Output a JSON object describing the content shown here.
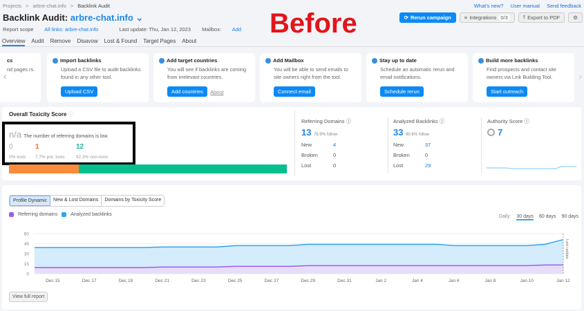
{
  "breadcrumb": [
    "Projects",
    ">",
    "arbre-chat.info",
    ">",
    "Backlink Audit"
  ],
  "header": {
    "title": "Backlink Audit:",
    "domain": "arbre-chat.info ⌄",
    "scope_label": "Report scope",
    "scope_value": "All links: arbre-chat.info",
    "last_update": "Last update: Thu, Jan 12, 2023",
    "mailbox_label": "Mailbox:",
    "mailbox_value": "Add"
  },
  "annotation": "Before",
  "toplinks": [
    "What's new?",
    "User manual",
    "Send feedback"
  ],
  "buttons": {
    "rerun": "Rerun campaign",
    "integrations": "Integrations",
    "integrations_count": "0/3",
    "export": "Export to PDF"
  },
  "tabs": [
    "Overview",
    "Audit",
    "Remove",
    "Disavow",
    "Lost & Found",
    "Target Pages",
    "About"
  ],
  "cards": [
    {
      "title": "cs",
      "text": "nd pages rs."
    },
    {
      "title": "Import backlinks",
      "text": "Upload a CSV file to audit backlinks found in any other tool.",
      "button": "Upload CSV"
    },
    {
      "title": "Add target countries",
      "text": "You will see if backlinks are coming from irrelevant countries.",
      "button": "Add countries",
      "link": "About"
    },
    {
      "title": "Add Mailbox",
      "text": "You will be able to send emails to site owners right from the tool.",
      "button": "Connect email"
    },
    {
      "title": "Stay up to date",
      "text": "Schedule an automatic rerun and email notifications.",
      "button": "Schedule rerun"
    },
    {
      "title": "Build more backlinks",
      "text": "Find prospects and contact site owners via Link Building Tool.",
      "button": "Start outreach"
    }
  ],
  "toxicity": {
    "title": "Overall Toxicity Score",
    "score": "n/a",
    "message": "The number of referring domains is low.",
    "toxic": "0",
    "toxic_label": "0% toxic",
    "pot": "1",
    "pot_label": "7.7% pot. toxic",
    "non": "12",
    "non_label": "92.3% non-toxic",
    "bar_fractions": {
      "toxic": 0,
      "pot": 0.077,
      "non": 0.923
    }
  },
  "referring": {
    "label": "Referring Domains",
    "value": "13",
    "sub": "76.9% follow",
    "new": "4",
    "broken": "0",
    "lost": "0"
  },
  "backlinks": {
    "label": "Analyzed Backlinks",
    "value": "33",
    "sub": "60.6% follow",
    "new": "37",
    "broken": "0",
    "lost": "29"
  },
  "row_labels": {
    "new": "New",
    "broken": "Broken",
    "lost": "Lost"
  },
  "authority": {
    "label": "Authority Score",
    "value": "7"
  },
  "chart_tabs": [
    "Profile Dynamic",
    "New & Lost Domains",
    "Domains by Toxicity Score"
  ],
  "legend": {
    "ref": "Referring domains",
    "back": "Analyzed backlinks"
  },
  "period": {
    "label": "Daily:",
    "options": [
      "30 days",
      "60 days",
      "90 days"
    ]
  },
  "view_full": "View full report",
  "chart_data": {
    "type": "area",
    "x": [
      "Dec 14",
      "Dec 15",
      "Dec 16",
      "Dec 17",
      "Dec 18",
      "Dec 19",
      "Dec 20",
      "Dec 21",
      "Dec 22",
      "Dec 23",
      "Dec 24",
      "Dec 25",
      "Dec 26",
      "Dec 27",
      "Dec 28",
      "Dec 29",
      "Dec 30",
      "Dec 31",
      "Jan 1",
      "Jan 2",
      "Jan 3",
      "Jan 4",
      "Jan 5",
      "Jan 6",
      "Jan 7",
      "Jan 8",
      "Jan 9",
      "Jan 10",
      "Jan 11",
      "Jan 12"
    ],
    "tick_labels": [
      "Dec 15",
      "Dec 17",
      "Dec 19",
      "Dec 21",
      "Dec 23",
      "Dec 25",
      "Dec 27",
      "Dec 29",
      "Dec 31",
      "Jan 2",
      "Jan 4",
      "Jan 6",
      "Jan 8",
      "Jan 10",
      "Jan 12"
    ],
    "yticks": [
      "60",
      "45",
      "30",
      "15",
      "0"
    ],
    "ylim": [
      0,
      60
    ],
    "annotation": "Last update",
    "series": [
      {
        "name": "Analyzed backlinks",
        "color": "#2fa6f0",
        "values": [
          39,
          39,
          39,
          39,
          39,
          39,
          39,
          40,
          40,
          40,
          40,
          42,
          42,
          42,
          42,
          44,
          44,
          44,
          44,
          44,
          44,
          44,
          44,
          42,
          42,
          42,
          42,
          42,
          44,
          51
        ]
      },
      {
        "name": "Referring domains",
        "color": "#9b5cf0",
        "values": [
          9,
          9,
          9,
          9,
          9,
          9,
          9,
          10,
          10,
          10,
          10,
          11,
          11,
          11,
          11,
          12,
          12,
          12,
          12,
          12,
          12,
          12,
          12,
          12,
          12,
          12,
          12,
          12,
          13,
          13
        ]
      }
    ]
  }
}
